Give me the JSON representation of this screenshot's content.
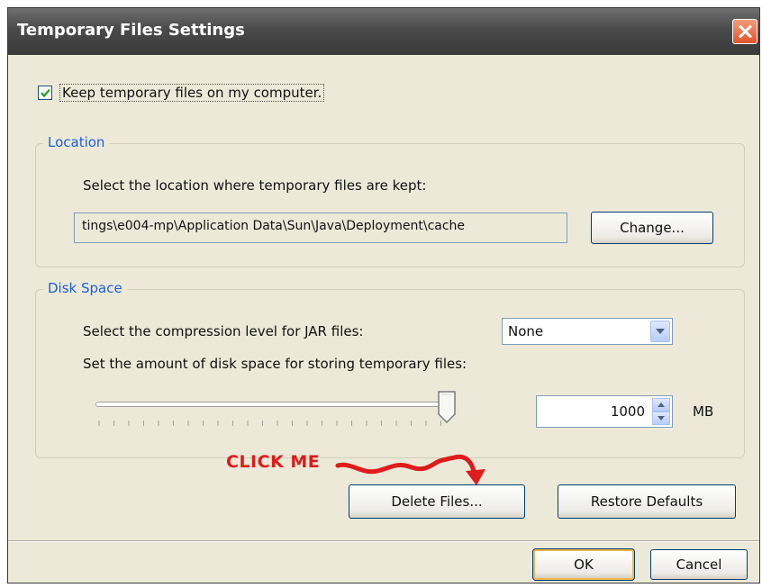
{
  "window": {
    "title": "Temporary Files Settings",
    "close_icon": "close-icon"
  },
  "keep_files": {
    "checked": true,
    "label": "Keep temporary files on my computer."
  },
  "location": {
    "group_title": "Location",
    "instruction": "Select the location where temporary files are kept:",
    "path": "tings\\e004-mp\\Application Data\\Sun\\Java\\Deployment\\cache",
    "change_label": "Change..."
  },
  "disk_space": {
    "group_title": "Disk Space",
    "compression_label": "Select the compression level for JAR files:",
    "compression_value": "None",
    "amount_label": "Set the amount of disk space for storing temporary files:",
    "amount_value": "1000",
    "unit": "MB",
    "slider_position": 1.0
  },
  "annotation": {
    "text": "CLICK ME",
    "color": "#e01b1b"
  },
  "actions": {
    "delete_label": "Delete Files...",
    "restore_label": "Restore Defaults"
  },
  "footer": {
    "ok_label": "OK",
    "cancel_label": "Cancel"
  },
  "colors": {
    "title_bar": "#4a4a4a",
    "group_title": "#1d5eda",
    "dialog_bg": "#ece9d8",
    "close": "#e0542a"
  }
}
